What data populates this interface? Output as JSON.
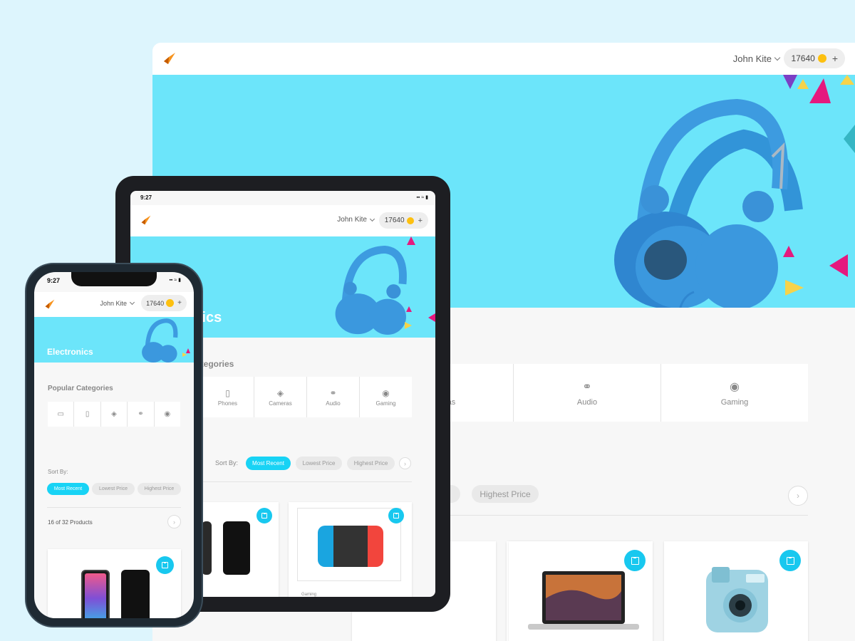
{
  "user": {
    "name": "John Kite",
    "balance": "17640",
    "add_symbol": "+"
  },
  "status_time": "9:27",
  "hero": {
    "title": "Electronics",
    "title_partial": "onics"
  },
  "categories_heading": "Popular Categories",
  "categories_heading_partial": "ategories",
  "categories": [
    {
      "label": "Laptops",
      "icon": "laptop-icon"
    },
    {
      "label": "Phones",
      "icon": "phone-icon"
    },
    {
      "label": "Cameras",
      "icon": "camera-icon"
    },
    {
      "label": "Audio",
      "icon": "headphones-icon"
    },
    {
      "label": "Gaming",
      "icon": "gamepad-icon"
    }
  ],
  "sort": {
    "label": "Sort By:",
    "options": [
      "Most Recent",
      "Lowest Price",
      "Highest Price"
    ],
    "selected": "Most Recent"
  },
  "products_count": "16 of 32 Products",
  "product_card_category": "Gaming",
  "colors": {
    "accent": "#18d3f5",
    "hero": "#6ce5fa",
    "logo": "#f7931e",
    "coin": "#fdc010"
  }
}
